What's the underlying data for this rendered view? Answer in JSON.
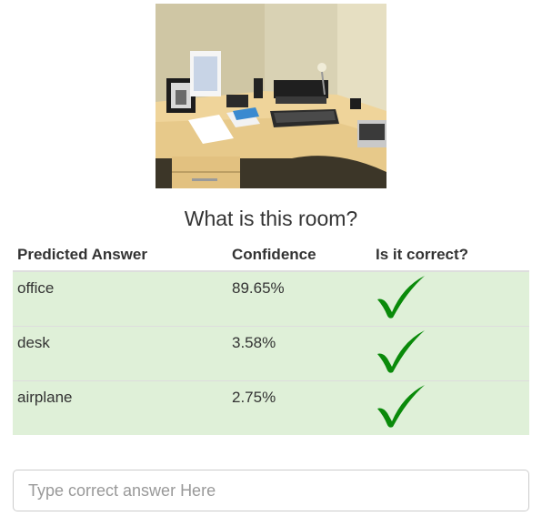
{
  "question": "What is this room?",
  "table": {
    "headers": [
      "Predicted Answer",
      "Confidence",
      "Is it correct?"
    ],
    "rows": [
      {
        "answer": "office",
        "confidence": "89.65%",
        "correct": true
      },
      {
        "answer": "desk",
        "confidence": "3.58%",
        "correct": true
      },
      {
        "answer": "airplane",
        "confidence": "2.75%",
        "correct": true
      }
    ]
  },
  "input": {
    "placeholder": "Type correct answer Here",
    "value": ""
  },
  "colors": {
    "row_background": "#dff0d8",
    "checkmark": "#0a8a0a"
  },
  "icons": {
    "row_status": "checkmark-icon"
  }
}
